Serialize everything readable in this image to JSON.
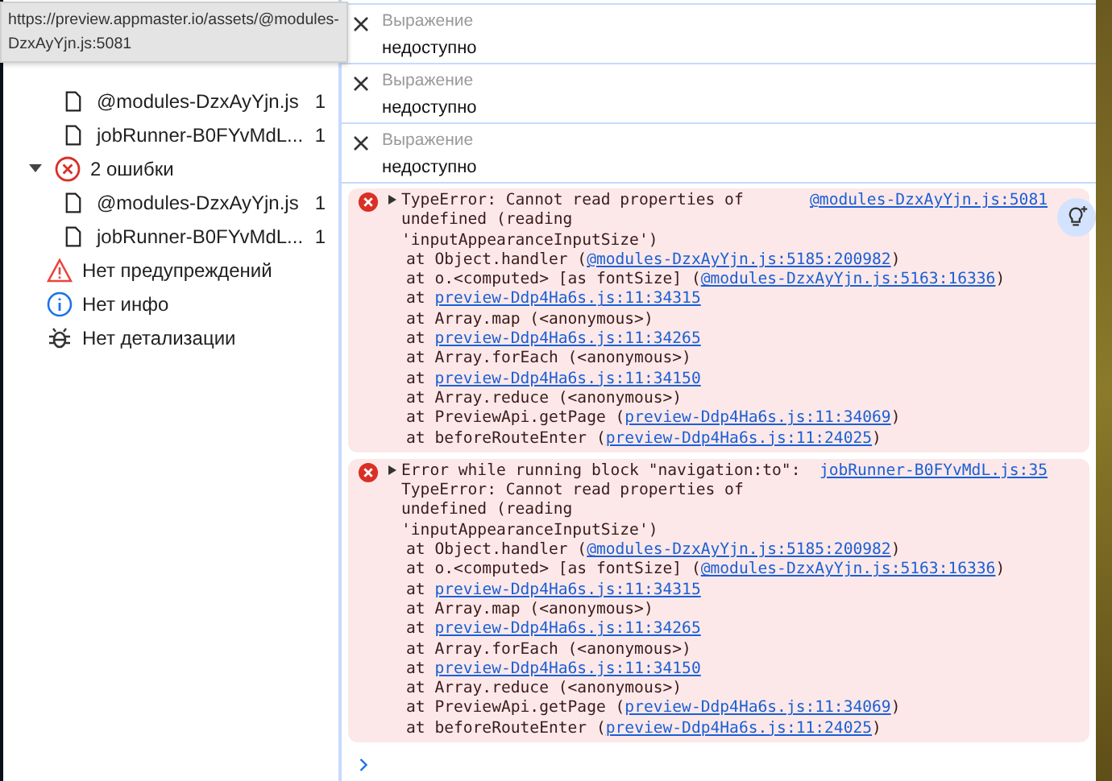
{
  "tooltip": {
    "text": "https://preview.appmaster.io/assets/@modules-DzxAyYjn.js:5081"
  },
  "sidebar": {
    "items": [
      {
        "kind": "file",
        "label": "@modules-DzxAyYjn.js",
        "count": "1"
      },
      {
        "kind": "file",
        "label": "jobRunner-B0FYvMdL...",
        "count": "1"
      },
      {
        "kind": "group",
        "label": "2 ошибки",
        "expanded": true,
        "children": [
          {
            "kind": "file",
            "label": "@modules-DzxAyYjn.js",
            "count": "1"
          },
          {
            "kind": "file",
            "label": "jobRunner-B0FYvMdL...",
            "count": "1"
          }
        ]
      },
      {
        "kind": "warning",
        "label": "Нет предупреждений"
      },
      {
        "kind": "info",
        "label": "Нет инфо"
      },
      {
        "kind": "verbose",
        "label": "Нет детализации"
      }
    ]
  },
  "watch": [
    {
      "label": "Выражение",
      "value": "недоступно"
    },
    {
      "label": "Выражение",
      "value": "недоступно"
    },
    {
      "label": "Выражение",
      "value": "недоступно"
    }
  ],
  "messages": [
    {
      "kind": "error",
      "expanded": false,
      "text": "TypeError: Cannot read properties of undefined (reading 'inputAppearanceInputSize')",
      "source": "@modules-DzxAyYjn.js:5081",
      "insights": true,
      "stack": [
        {
          "text": "at Object.handler (",
          "link": "@modules-DzxAyYjn.js:5185:200982",
          "after": ")"
        },
        {
          "text": "at o.<computed> [as fontSize] (",
          "link": "@modules-DzxAyYjn.js:5163:16336",
          "after": ")"
        },
        {
          "text": "at ",
          "link": "preview-Ddp4Ha6s.js:11:34315"
        },
        {
          "text": "at Array.map (<anonymous>)"
        },
        {
          "text": "at ",
          "link": "preview-Ddp4Ha6s.js:11:34265"
        },
        {
          "text": "at Array.forEach (<anonymous>)"
        },
        {
          "text": "at ",
          "link": "preview-Ddp4Ha6s.js:11:34150"
        },
        {
          "text": "at Array.reduce (<anonymous>)"
        },
        {
          "text": "at PreviewApi.getPage (",
          "link": "preview-Ddp4Ha6s.js:11:34069",
          "after": ")"
        },
        {
          "text": "at beforeRouteEnter (",
          "link": "preview-Ddp4Ha6s.js:11:24025",
          "after": ")"
        }
      ]
    },
    {
      "kind": "error",
      "expanded": false,
      "text": "Error while running block \"navigation:to\": TypeError: Cannot read properties of undefined (reading 'inputAppearanceInputSize')",
      "source": "jobRunner-B0FYvMdL.js:35",
      "insights": false,
      "stack": [
        {
          "text": "at Object.handler (",
          "link": "@modules-DzxAyYjn.js:5185:200982",
          "after": ")"
        },
        {
          "text": "at o.<computed> [as fontSize] (",
          "link": "@modules-DzxAyYjn.js:5163:16336",
          "after": ")"
        },
        {
          "text": "at ",
          "link": "preview-Ddp4Ha6s.js:11:34315"
        },
        {
          "text": "at Array.map (<anonymous>)"
        },
        {
          "text": "at ",
          "link": "preview-Ddp4Ha6s.js:11:34265"
        },
        {
          "text": "at Array.forEach (<anonymous>)"
        },
        {
          "text": "at ",
          "link": "preview-Ddp4Ha6s.js:11:34150"
        },
        {
          "text": "at Array.reduce (<anonymous>)"
        },
        {
          "text": "at PreviewApi.getPage (",
          "link": "preview-Ddp4Ha6s.js:11:34069",
          "after": ")"
        },
        {
          "text": "at beforeRouteEnter (",
          "link": "preview-Ddp4Ha6s.js:11:24025",
          "after": ")"
        }
      ]
    }
  ]
}
